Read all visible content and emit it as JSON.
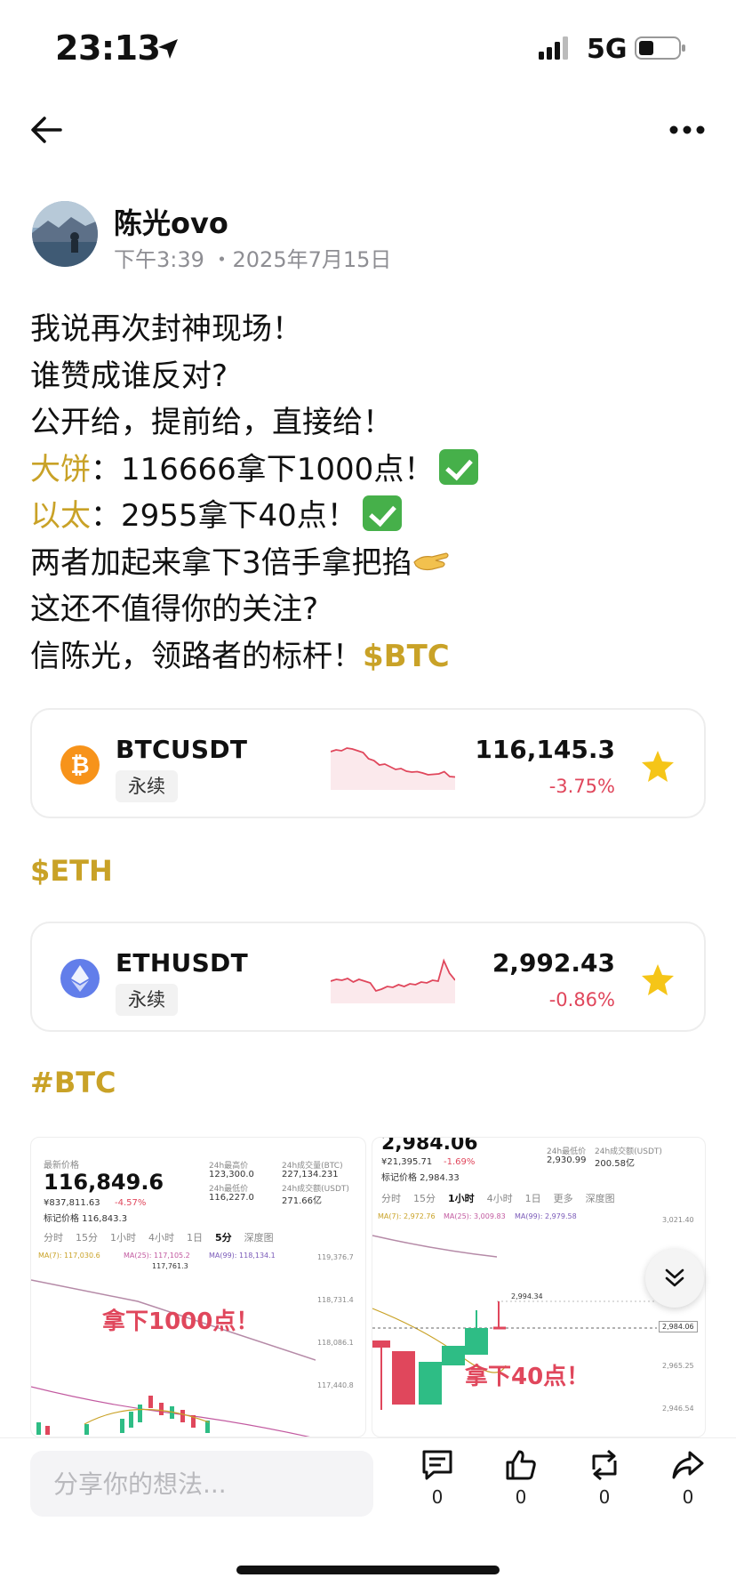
{
  "status_bar": {
    "time": "23:13",
    "network": "5G",
    "icons": [
      "location-arrow-icon",
      "signal-bars-icon",
      "battery-icon"
    ]
  },
  "nav": {
    "back_icon": "back-arrow-icon",
    "more_icon": "more-dots-icon"
  },
  "author": {
    "name": "陈光ovo",
    "time": "下午3:39 ・2025年7月15日"
  },
  "post": {
    "line1": "我说再次封神现场！",
    "line2": "谁赞成谁反对?",
    "line3": "公开给，提前给，直接给！",
    "line4_label": "大饼",
    "line4_text": "：116666拿下1000点！",
    "line5_label": "以太",
    "line5_text": "：2955拿下40点！",
    "line6": "两者加起来拿下3倍手拿把掐",
    "line7": "这还不值得你的关注?",
    "line8_text": "信陈光，领路者的标杆！",
    "line8_tag": "$BTC"
  },
  "tickers": [
    {
      "symbol": "BTCUSDT",
      "type": "永续",
      "price": "116,145.3",
      "change": "-3.75%",
      "icon": "bitcoin-icon",
      "color": "#f7931a",
      "sparkline": [
        0.78,
        0.82,
        0.8,
        0.86,
        0.84,
        0.8,
        0.76,
        0.62,
        0.58,
        0.48,
        0.5,
        0.44,
        0.38,
        0.4,
        0.34,
        0.32,
        0.33,
        0.3,
        0.26,
        0.27,
        0.28,
        0.33,
        0.22,
        0.21
      ]
    },
    {
      "symbol": "ETHUSDT",
      "type": "永续",
      "price": "2,992.43",
      "change": "-0.86%",
      "icon": "ethereum-icon",
      "color": "#627eea",
      "sparkline": [
        0.42,
        0.46,
        0.44,
        0.48,
        0.4,
        0.46,
        0.42,
        0.38,
        0.2,
        0.24,
        0.3,
        0.28,
        0.34,
        0.3,
        0.36,
        0.34,
        0.4,
        0.38,
        0.44,
        0.42,
        0.88,
        0.6,
        0.44
      ]
    }
  ],
  "hashtags": {
    "eth": "$ETH",
    "btc": "#BTC"
  },
  "image_left": {
    "price_label": "最新价格",
    "price": "116,849.6",
    "sub_price": "¥837,811.63",
    "sub_change": "-4.57%",
    "mark_price": "标记价格 116,843.3",
    "high_label": "24h最高价",
    "high": "123,300.0",
    "low_label": "24h最低价",
    "low": "116,227.0",
    "vol_label": "24h成交量(BTC)",
    "vol": "227,134.231",
    "amt_label": "24h成交额(USDT)",
    "amt": "271.66亿",
    "tabs": [
      "分时",
      "15分",
      "1小时",
      "4小时",
      "1日",
      "5分",
      "深度图"
    ],
    "ma7": "MA(7): 117,030.6",
    "ma25": "MA(25): 117,105.2",
    "ma99": "MA(99): 118,134.1",
    "axis": [
      "119,376.7",
      "118,731.4",
      "118,086.1",
      "117,440.8"
    ],
    "marker": "117,761.3",
    "overlay": "拿下1000点！"
  },
  "image_right": {
    "price": "2,984.06",
    "sub_price": "¥21,395.71",
    "sub_change": "-1.69%",
    "mark_price": "标记价格 2,984.33",
    "low_label": "24h最低价",
    "low": "2,930.99",
    "amt_label": "24h成交额(USDT)",
    "amt": "200.58亿",
    "tabs": [
      "分时",
      "15分",
      "1小时",
      "4小时",
      "1日",
      "更多",
      "深度图"
    ],
    "ma7": "MA(7): 2,972.76",
    "ma25": "MA(25): 3,009.83",
    "ma99": "MA(99): 2,979.58",
    "axis": [
      "3,021.40",
      "2,984.06",
      "2,965.25",
      "2,946.54"
    ],
    "marker": "2,994.34",
    "overlay": "拿下40点！"
  },
  "bottom": {
    "placeholder": "分享你的想法...",
    "comments": "0",
    "likes": "0",
    "reposts": "0",
    "shares": "0"
  },
  "colors": {
    "accent_gold": "#c9a227",
    "negative": "#e0475c",
    "star": "#f5c518"
  }
}
